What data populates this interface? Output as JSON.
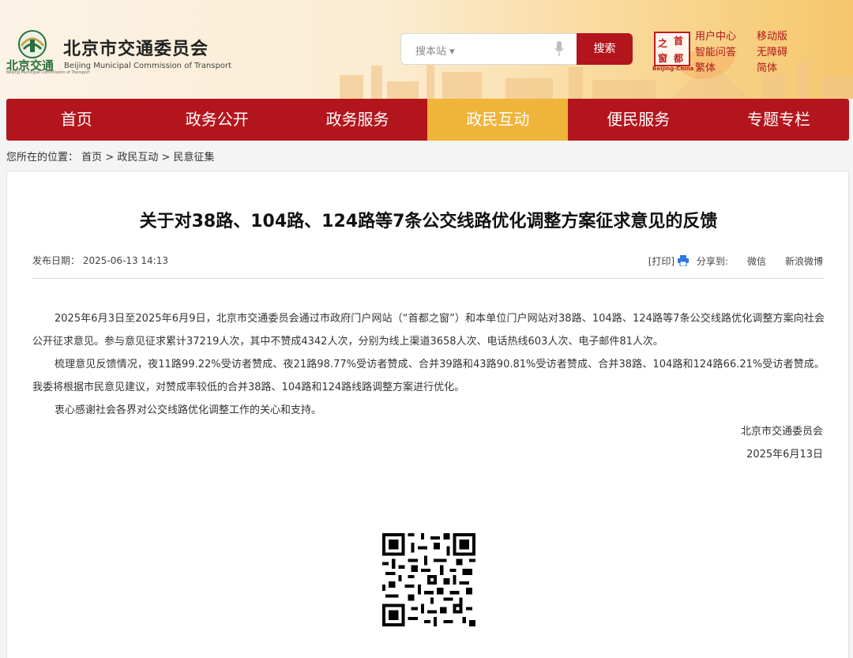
{
  "header": {
    "logo_short": "北京交通",
    "logo_tiny": "Beijing Municipal Commission of Transport",
    "title": "北京市交通委员会",
    "subtitle_en": "Beijing Municipal Commission of Transport"
  },
  "search": {
    "placeholder": "搜本站",
    "button_label": "搜索"
  },
  "capital_window": {
    "chars": [
      "之",
      "首",
      "窗",
      "都"
    ],
    "sub": "Beijing-China"
  },
  "toplinks": {
    "user_center": "用户中心",
    "mobile": "移动版",
    "smart_qa": "智能问答",
    "accessible": "无障碍",
    "traditional": "繁体",
    "simplified": "简体"
  },
  "nav": {
    "items": [
      "首页",
      "政务公开",
      "政务服务",
      "政民互动",
      "便民服务",
      "专题专栏"
    ],
    "active_index": 3
  },
  "breadcrumb": {
    "prefix": "您所在的位置：",
    "items": [
      "首页",
      "政民互动",
      "民意征集"
    ],
    "separator": " > "
  },
  "article": {
    "title": "关于对38路、104路、124路等7条公交线路优化调整方案征求意见的反馈",
    "date_label": "发布日期：",
    "date": "2025-06-13 14:13",
    "print_label": "[打印]",
    "share_label": "分享到:",
    "share_wechat": "微信",
    "share_weibo": "新浪微博",
    "paragraphs": [
      "2025年6月3日至2025年6月9日，北京市交通委员会通过市政府门户网站（“首都之窗”）和本单位门户网站对38路、104路、124路等7条公交线路优化调整方案向社会公开征求意见。参与意见征求累计37219人次，其中不赞成4342人次，分别为线上渠道3658人次、电话热线603人次、电子邮件81人次。",
      "梳理意见反馈情况，夜11路99.22%受访者赞成、夜21路98.77%受访者赞成、合并39路和43路90.81%受访者赞成、合并38路、104路和124路66.21%受访者赞成。我委将根据市民意见建议，对赞成率较低的合并38路、104路和124路线路调整方案进行优化。",
      "衷心感谢社会各界对公交线路优化调整工作的关心和支持。"
    ],
    "signature": "北京市交通委员会",
    "sign_date": "2025年6月13日"
  },
  "colors": {
    "brand_red": "#b3151c",
    "nav_active": "#f0b43a"
  }
}
